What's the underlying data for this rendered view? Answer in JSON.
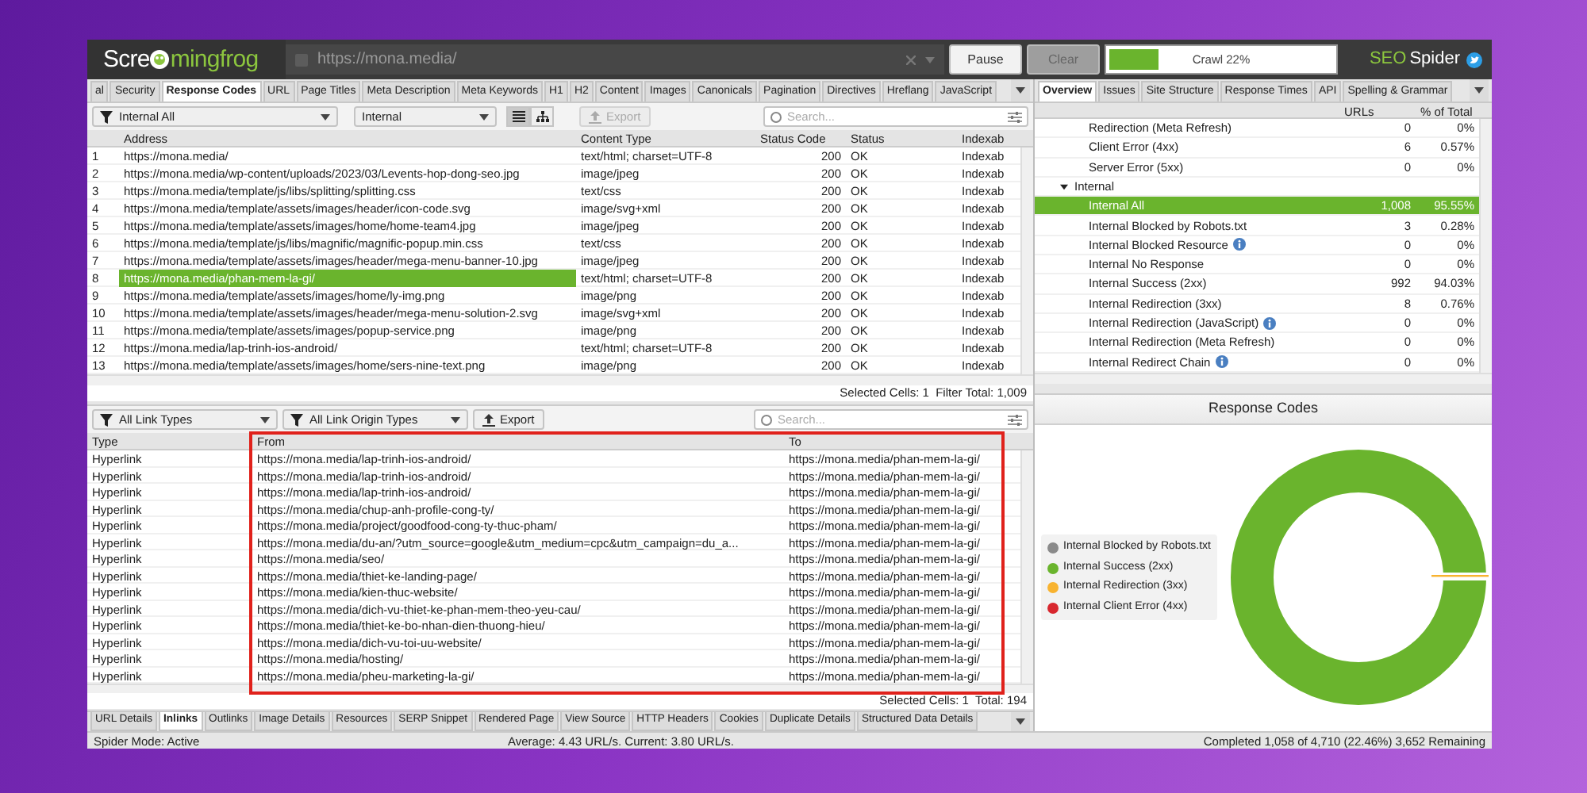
{
  "top_bar": {
    "logo_left": "Scre",
    "logo_right": "mingfrog",
    "url": "https://mona.media/",
    "buttons": [
      {
        "label": "Pause",
        "disabled": false
      },
      {
        "label": "Clear",
        "disabled": true
      }
    ],
    "progress": {
      "label": "Crawl 22%",
      "level": 0.22
    },
    "brand_left": "SEO",
    "brand_right": "Spider"
  },
  "main_tabs": [
    {
      "label": "al",
      "selected": false
    },
    {
      "label": "Security",
      "selected": false
    },
    {
      "label": "Response Codes",
      "selected": true
    },
    {
      "label": "URL",
      "selected": false
    },
    {
      "label": "Page Titles",
      "selected": false
    },
    {
      "label": "Meta Description",
      "selected": false
    },
    {
      "label": "Meta Keywords",
      "selected": false
    },
    {
      "label": "H1",
      "selected": false
    },
    {
      "label": "H2",
      "selected": false
    },
    {
      "label": "Content",
      "selected": false
    },
    {
      "label": "Images",
      "selected": false
    },
    {
      "label": "Canonicals",
      "selected": false
    },
    {
      "label": "Pagination",
      "selected": false
    },
    {
      "label": "Directives",
      "selected": false
    },
    {
      "label": "Hreflang",
      "selected": false
    },
    {
      "label": "JavaScript",
      "selected": false
    }
  ],
  "filter_bar": {
    "filter": "Internal All",
    "subfilter": "Internal",
    "view_modes": [
      {
        "kind": "list",
        "selected": true
      },
      {
        "kind": "tree",
        "selected": false
      }
    ],
    "export": {
      "label": "Export",
      "disabled": true
    },
    "search_placeholder": "Search..."
  },
  "table": {
    "columns": [
      "Address",
      "Content Type",
      "Status Code",
      "Status",
      "Indexab"
    ],
    "rows": [
      {
        "index": "1",
        "address": "https://mona.media/",
        "content_type": "text/html; charset=UTF-8",
        "status_code": "200",
        "status": "OK",
        "indexability": "Indexab",
        "selected": false
      },
      {
        "index": "2",
        "address": "https://mona.media/wp-content/uploads/2023/03/Levents-hop-dong-seo.jpg",
        "content_type": "image/jpeg",
        "status_code": "200",
        "status": "OK",
        "indexability": "Indexab",
        "selected": false
      },
      {
        "index": "3",
        "address": "https://mona.media/template/js/libs/splitting/splitting.css",
        "content_type": "text/css",
        "status_code": "200",
        "status": "OK",
        "indexability": "Indexab",
        "selected": false
      },
      {
        "index": "4",
        "address": "https://mona.media/template/assets/images/header/icon-code.svg",
        "content_type": "image/svg+xml",
        "status_code": "200",
        "status": "OK",
        "indexability": "Indexab",
        "selected": false
      },
      {
        "index": "5",
        "address": "https://mona.media/template/assets/images/home/home-team4.jpg",
        "content_type": "image/jpeg",
        "status_code": "200",
        "status": "OK",
        "indexability": "Indexab",
        "selected": false
      },
      {
        "index": "6",
        "address": "https://mona.media/template/js/libs/magnific/magnific-popup.min.css",
        "content_type": "text/css",
        "status_code": "200",
        "status": "OK",
        "indexability": "Indexab",
        "selected": false
      },
      {
        "index": "7",
        "address": "https://mona.media/template/assets/images/header/mega-menu-banner-10.jpg",
        "content_type": "image/jpeg",
        "status_code": "200",
        "status": "OK",
        "indexability": "Indexab",
        "selected": false
      },
      {
        "index": "8",
        "address": "https://mona.media/phan-mem-la-gi/",
        "content_type": "text/html; charset=UTF-8",
        "status_code": "200",
        "status": "OK",
        "indexability": "Indexab",
        "selected": true
      },
      {
        "index": "9",
        "address": "https://mona.media/template/assets/images/home/ly-img.png",
        "content_type": "image/png",
        "status_code": "200",
        "status": "OK",
        "indexability": "Indexab",
        "selected": false
      },
      {
        "index": "10",
        "address": "https://mona.media/template/assets/images/header/mega-menu-solution-2.svg",
        "content_type": "image/svg+xml",
        "status_code": "200",
        "status": "OK",
        "indexability": "Indexab",
        "selected": false
      },
      {
        "index": "11",
        "address": "https://mona.media/template/assets/images/popup-service.png",
        "content_type": "image/png",
        "status_code": "200",
        "status": "OK",
        "indexability": "Indexab",
        "selected": false
      },
      {
        "index": "12",
        "address": "https://mona.media/lap-trinh-ios-android/",
        "content_type": "text/html; charset=UTF-8",
        "status_code": "200",
        "status": "OK",
        "indexability": "Indexab",
        "selected": false
      },
      {
        "index": "13",
        "address": "https://mona.media/template/assets/images/home/sers-nine-text.png",
        "content_type": "image/png",
        "status_code": "200",
        "status": "OK",
        "indexability": "Indexab",
        "selected": false
      }
    ],
    "footer": "Selected Cells: 1  Filter Total: 1,009"
  },
  "links_panel": {
    "filters": [
      "All Link Types",
      "All Link Origin Types"
    ],
    "export": "Export",
    "search_placeholder": "Search...",
    "columns": [
      "Type",
      "From",
      "To"
    ],
    "rows": [
      {
        "type": "Hyperlink",
        "from": "https://mona.media/lap-trinh-ios-android/",
        "to": "https://mona.media/phan-mem-la-gi/"
      },
      {
        "type": "Hyperlink",
        "from": "https://mona.media/lap-trinh-ios-android/",
        "to": "https://mona.media/phan-mem-la-gi/"
      },
      {
        "type": "Hyperlink",
        "from": "https://mona.media/lap-trinh-ios-android/",
        "to": "https://mona.media/phan-mem-la-gi/"
      },
      {
        "type": "Hyperlink",
        "from": "https://mona.media/chup-anh-profile-cong-ty/",
        "to": "https://mona.media/phan-mem-la-gi/"
      },
      {
        "type": "Hyperlink",
        "from": "https://mona.media/project/goodfood-cong-ty-thuc-pham/",
        "to": "https://mona.media/phan-mem-la-gi/"
      },
      {
        "type": "Hyperlink",
        "from": "https://mona.media/du-an/?utm_source=google&utm_medium=cpc&utm_campaign=du_a...",
        "to": "https://mona.media/phan-mem-la-gi/"
      },
      {
        "type": "Hyperlink",
        "from": "https://mona.media/seo/",
        "to": "https://mona.media/phan-mem-la-gi/"
      },
      {
        "type": "Hyperlink",
        "from": "https://mona.media/thiet-ke-landing-page/",
        "to": "https://mona.media/phan-mem-la-gi/"
      },
      {
        "type": "Hyperlink",
        "from": "https://mona.media/kien-thuc-website/",
        "to": "https://mona.media/phan-mem-la-gi/"
      },
      {
        "type": "Hyperlink",
        "from": "https://mona.media/dich-vu-thiet-ke-phan-mem-theo-yeu-cau/",
        "to": "https://mona.media/phan-mem-la-gi/"
      },
      {
        "type": "Hyperlink",
        "from": "https://mona.media/thiet-ke-bo-nhan-dien-thuong-hieu/",
        "to": "https://mona.media/phan-mem-la-gi/"
      },
      {
        "type": "Hyperlink",
        "from": "https://mona.media/dich-vu-toi-uu-website/",
        "to": "https://mona.media/phan-mem-la-gi/"
      },
      {
        "type": "Hyperlink",
        "from": "https://mona.media/hosting/",
        "to": "https://mona.media/phan-mem-la-gi/"
      },
      {
        "type": "Hyperlink",
        "from": "https://mona.media/pheu-marketing-la-gi/",
        "to": "https://mona.media/phan-mem-la-gi/"
      }
    ],
    "footer": "Selected Cells: 1  Total: 194"
  },
  "detail_tabs": [
    {
      "label": "URL Details",
      "selected": false
    },
    {
      "label": "Inlinks",
      "selected": true
    },
    {
      "label": "Outlinks",
      "selected": false
    },
    {
      "label": "Image Details",
      "selected": false
    },
    {
      "label": "Resources",
      "selected": false
    },
    {
      "label": "SERP Snippet",
      "selected": false
    },
    {
      "label": "Rendered Page",
      "selected": false
    },
    {
      "label": "View Source",
      "selected": false
    },
    {
      "label": "HTTP Headers",
      "selected": false
    },
    {
      "label": "Cookies",
      "selected": false
    },
    {
      "label": "Duplicate Details",
      "selected": false
    },
    {
      "label": "Structured Data Details",
      "selected": false
    }
  ],
  "overview": {
    "tabs": [
      {
        "label": "Overview",
        "selected": true
      },
      {
        "label": "Issues",
        "selected": false
      },
      {
        "label": "Site Structure",
        "selected": false
      },
      {
        "label": "Response Times",
        "selected": false
      },
      {
        "label": "API",
        "selected": false
      },
      {
        "label": "Spelling & Grammar",
        "selected": false
      }
    ],
    "columns": [
      "URLs",
      "% of Total"
    ],
    "tree": [
      {
        "children": [
          {
            "label": "Redirection (Meta Refresh)",
            "urls": "0",
            "percent": "0%",
            "selected": false,
            "info": false
          },
          {
            "label": "Client Error (4xx)",
            "urls": "6",
            "percent": "0.57%",
            "selected": false,
            "info": false
          },
          {
            "label": "Server Error (5xx)",
            "urls": "0",
            "percent": "0%",
            "selected": false,
            "info": false
          }
        ]
      },
      {
        "label": "Internal",
        "expanded": true,
        "children": [
          {
            "label": "Internal All",
            "urls": "1,008",
            "percent": "95.55%",
            "selected": true,
            "info": false
          },
          {
            "label": "Internal Blocked by Robots.txt",
            "urls": "3",
            "percent": "0.28%",
            "selected": false,
            "info": false
          },
          {
            "label": "Internal Blocked Resource",
            "urls": "0",
            "percent": "0%",
            "selected": false,
            "info": true
          },
          {
            "label": "Internal No Response",
            "urls": "0",
            "percent": "0%",
            "selected": false,
            "info": false
          },
          {
            "label": "Internal Success (2xx)",
            "urls": "992",
            "percent": "94.03%",
            "selected": false,
            "info": false
          },
          {
            "label": "Internal Redirection (3xx)",
            "urls": "8",
            "percent": "0.76%",
            "selected": false,
            "info": false
          },
          {
            "label": "Internal Redirection (JavaScript)",
            "urls": "0",
            "percent": "0%",
            "selected": false,
            "info": true
          },
          {
            "label": "Internal Redirection (Meta Refresh)",
            "urls": "0",
            "percent": "0%",
            "selected": false,
            "info": false
          },
          {
            "label": "Internal Redirect Chain",
            "urls": "0",
            "percent": "0%",
            "selected": false,
            "info": true
          }
        ]
      }
    ]
  },
  "chart": {
    "title": "Response Codes",
    "legend": [
      {
        "label": "Internal Blocked by Robots.txt",
        "color": "#8a8a8a"
      },
      {
        "label": "Internal Success (2xx)",
        "color": "#6ab42d"
      },
      {
        "label": "Internal Redirection (3xx)",
        "color": "#f8b330"
      },
      {
        "label": "Internal Client Error (4xx)",
        "color": "#d8272e"
      }
    ]
  },
  "status_bar": {
    "mode": "Spider Mode: Active",
    "rate": "Average: 4.43 URL/s. Current: 3.80 URL/s.",
    "progress": "Completed 1,058 of 4,710 (22.46%) 3,652 Remaining"
  }
}
